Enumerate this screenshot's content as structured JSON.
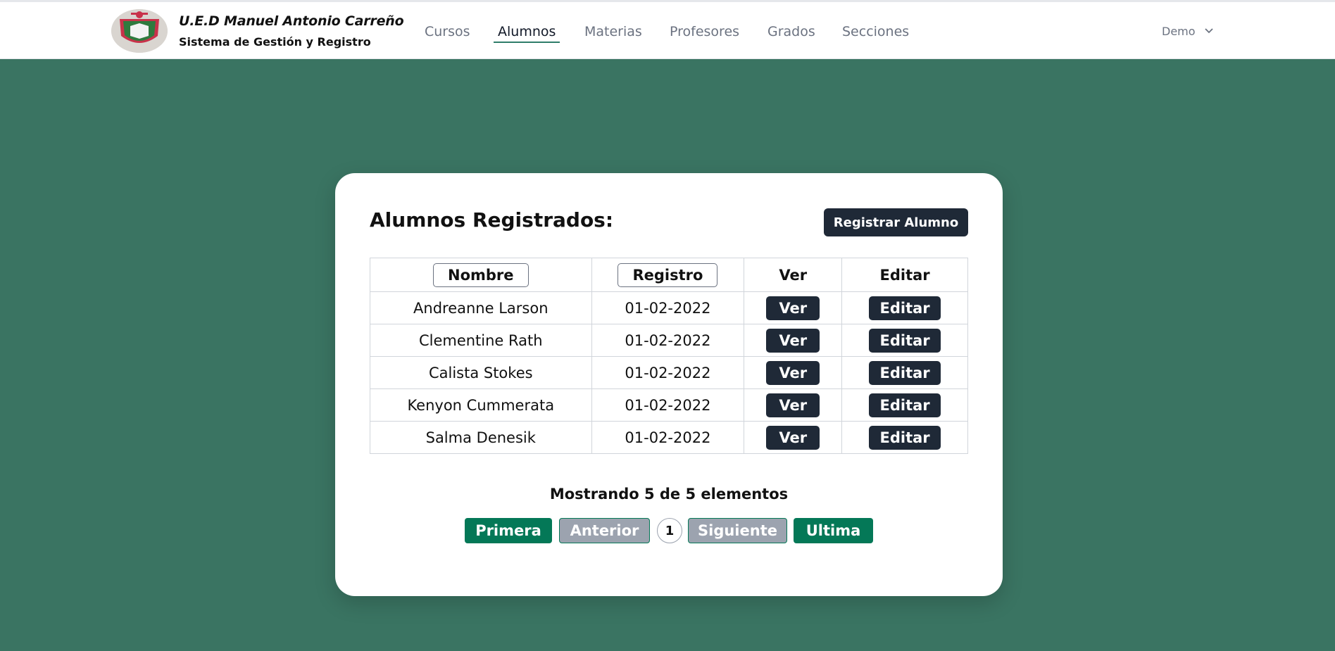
{
  "brand": {
    "title": "U.E.D Manuel Antonio Carreño",
    "subtitle": "Sistema de Gestión y Registro"
  },
  "nav": {
    "items": [
      {
        "label": "Cursos"
      },
      {
        "label": "Alumnos",
        "active": true
      },
      {
        "label": "Materias"
      },
      {
        "label": "Profesores"
      },
      {
        "label": "Grados"
      },
      {
        "label": "Secciones"
      }
    ],
    "user": "Demo"
  },
  "card": {
    "title": "Alumnos Registrados:",
    "register_label": "Registrar Alumno"
  },
  "table": {
    "headers": {
      "name": "Nombre",
      "registro": "Registro",
      "ver": "Ver",
      "editar": "Editar"
    },
    "view_label": "Ver",
    "edit_label": "Editar",
    "rows": [
      {
        "name": "Andreanne Larson",
        "date": "01-02-2022"
      },
      {
        "name": "Clementine Rath",
        "date": "01-02-2022"
      },
      {
        "name": "Calista Stokes",
        "date": "01-02-2022"
      },
      {
        "name": "Kenyon Cummerata",
        "date": "01-02-2022"
      },
      {
        "name": "Salma Denesik",
        "date": "01-02-2022"
      }
    ]
  },
  "pagination": {
    "summary": "Mostrando 5 de 5 elementos",
    "first": "Primera",
    "prev": "Anterior",
    "current": "1",
    "next": "Siguiente",
    "last": "Ultima"
  },
  "colors": {
    "background": "#3a7462",
    "primary_dark": "#1f2937",
    "pager_green": "#047857",
    "pager_disabled": "#9ca3af"
  }
}
